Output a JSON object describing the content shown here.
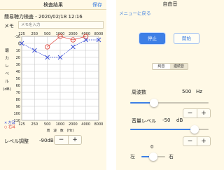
{
  "left_screen": {
    "nav_title": "検査結果",
    "save_label": "保存",
    "test_title": "簡易聴力検査 - 2020/02/18 12:16",
    "memo_label": "メモ",
    "memo_placeholder": "メモを入力",
    "audiogram": {
      "top_frequencies": [
        "125",
        "250",
        "500",
        "1000",
        "2000",
        "4000",
        "8000"
      ],
      "bottom_frequencies": [
        "125",
        "250",
        "500",
        "1000",
        "2000",
        "4000",
        "8000"
      ],
      "db_ticks": [
        "-10",
        "0",
        "10",
        "20",
        "30",
        "40",
        "50",
        "60",
        "70",
        "80",
        "90",
        "100",
        "110"
      ],
      "y_axis_label": [
        "聴",
        "力",
        "レ",
        "ベ",
        "ル",
        "(dB)"
      ],
      "x_axis_label": "周　波　数　(Hz)"
    },
    "chart_data": {
      "type": "line",
      "x": [
        125,
        250,
        500,
        1000,
        2000,
        4000,
        8000
      ],
      "xlabel": "周波数 (Hz)",
      "ylabel": "聴力レベル (dB)",
      "ylim": [
        -10,
        110
      ],
      "series": [
        {
          "name": "左耳",
          "marker": "x",
          "color": "#3b4fd6",
          "values": [
            0,
            10,
            20,
            20,
            5,
            -5,
            -5
          ]
        },
        {
          "name": "右耳",
          "marker": "o",
          "color": "#e0463c",
          "values": [
            null,
            null,
            5,
            -10,
            -5,
            -10,
            null
          ]
        }
      ]
    },
    "legend": {
      "left": "左耳",
      "right": "右耳"
    },
    "level_label": "レベル調整",
    "level_value": "-90dB",
    "minus": "−",
    "plus": "+"
  },
  "right_screen": {
    "nav_title": "自由音",
    "back_label": "メニューに戻る",
    "stop_label": "停止",
    "start_label": "開始",
    "segment_pure": "純音",
    "segment_continuous": "連続音",
    "frequency_label": "周波数",
    "frequency_value": "500",
    "frequency_unit": "Hz",
    "frequency_slider_level": 0.3,
    "volume_label": "音量レベル",
    "volume_value": "-50",
    "volume_unit": "dB",
    "volume_slider_level": 0.82,
    "balance_value": "0",
    "balance_slider_level": 0.5,
    "balance_left": "左",
    "balance_right": "右",
    "minus": "−",
    "plus": "+"
  },
  "colors": {
    "accent": "#3d7fe6",
    "background": "#fff9e6",
    "left_ear": "#3b4fd6",
    "right_ear": "#e0463c"
  }
}
